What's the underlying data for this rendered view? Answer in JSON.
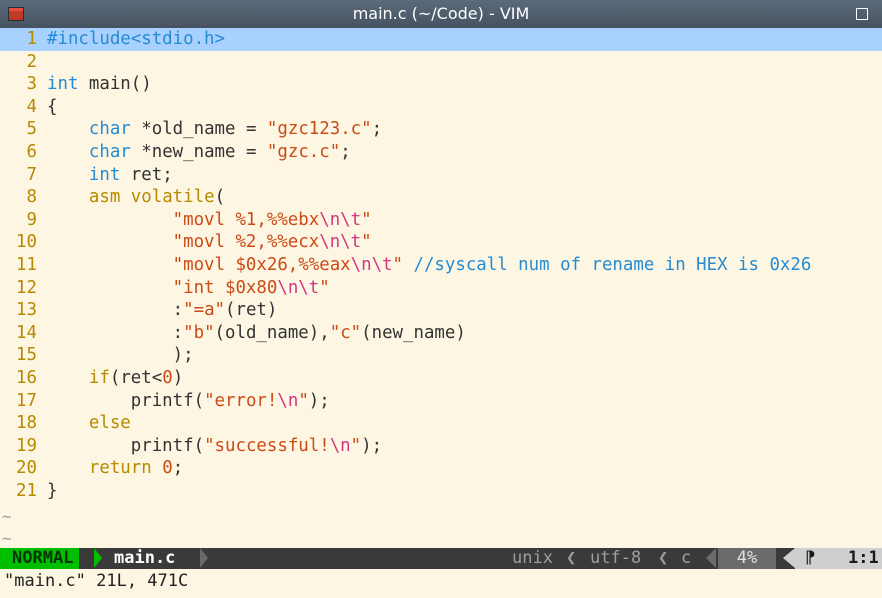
{
  "window": {
    "title": "main.c (~/Code) - VIM",
    "icon": "vim-app-icon"
  },
  "editor": {
    "lines": [
      {
        "n": "1",
        "segs": [
          {
            "t": "#include<stdio.h>",
            "c": "kw"
          }
        ]
      },
      {
        "n": "2",
        "segs": []
      },
      {
        "n": "3",
        "segs": [
          {
            "t": "int",
            "c": "kw"
          },
          {
            "t": " main()",
            "c": "code"
          }
        ]
      },
      {
        "n": "4",
        "segs": [
          {
            "t": "{",
            "c": "code"
          }
        ]
      },
      {
        "n": "5",
        "segs": [
          {
            "t": "    ",
            "c": "code"
          },
          {
            "t": "char",
            "c": "kw"
          },
          {
            "t": " *old_name = ",
            "c": "code"
          },
          {
            "t": "\"gzc123.c\"",
            "c": "strc"
          },
          {
            "t": ";",
            "c": "code"
          }
        ]
      },
      {
        "n": "6",
        "segs": [
          {
            "t": "    ",
            "c": "code"
          },
          {
            "t": "char",
            "c": "kw"
          },
          {
            "t": " *new_name = ",
            "c": "code"
          },
          {
            "t": "\"gzc.c\"",
            "c": "strc"
          },
          {
            "t": ";",
            "c": "code"
          }
        ]
      },
      {
        "n": "7",
        "segs": [
          {
            "t": "    ",
            "c": "code"
          },
          {
            "t": "int",
            "c": "kw"
          },
          {
            "t": " ret;",
            "c": "code"
          }
        ]
      },
      {
        "n": "8",
        "segs": [
          {
            "t": "    ",
            "c": "code"
          },
          {
            "t": "asm",
            "c": "kw2"
          },
          {
            "t": " ",
            "c": "code"
          },
          {
            "t": "volatile",
            "c": "kw2"
          },
          {
            "t": "(",
            "c": "code"
          }
        ]
      },
      {
        "n": "9",
        "segs": [
          {
            "t": "            ",
            "c": "code"
          },
          {
            "t": "\"movl %1,%%ebx",
            "c": "strc"
          },
          {
            "t": "\\n\\t",
            "c": "esc"
          },
          {
            "t": "\"",
            "c": "strc"
          }
        ]
      },
      {
        "n": "10",
        "segs": [
          {
            "t": "            ",
            "c": "code"
          },
          {
            "t": "\"movl %2,%%ecx",
            "c": "strc"
          },
          {
            "t": "\\n\\t",
            "c": "esc"
          },
          {
            "t": "\"",
            "c": "strc"
          }
        ]
      },
      {
        "n": "11",
        "segs": [
          {
            "t": "            ",
            "c": "code"
          },
          {
            "t": "\"movl $0x26,%%eax",
            "c": "strc"
          },
          {
            "t": "\\n\\t",
            "c": "esc"
          },
          {
            "t": "\"",
            "c": "strc"
          },
          {
            "t": " //syscall num of rename in HEX is 0x26",
            "c": "cmt"
          }
        ]
      },
      {
        "n": "12",
        "segs": [
          {
            "t": "            ",
            "c": "code"
          },
          {
            "t": "\"int $0x80",
            "c": "strc"
          },
          {
            "t": "\\n\\t",
            "c": "esc"
          },
          {
            "t": "\"",
            "c": "strc"
          }
        ]
      },
      {
        "n": "13",
        "segs": [
          {
            "t": "            :",
            "c": "code"
          },
          {
            "t": "\"=a\"",
            "c": "strc"
          },
          {
            "t": "(ret)",
            "c": "code"
          }
        ]
      },
      {
        "n": "14",
        "segs": [
          {
            "t": "            :",
            "c": "code"
          },
          {
            "t": "\"b\"",
            "c": "strc"
          },
          {
            "t": "(old_name),",
            "c": "code"
          },
          {
            "t": "\"c\"",
            "c": "strc"
          },
          {
            "t": "(new_name)",
            "c": "code"
          }
        ]
      },
      {
        "n": "15",
        "segs": [
          {
            "t": "            );",
            "c": "code"
          }
        ]
      },
      {
        "n": "16",
        "segs": [
          {
            "t": "    ",
            "c": "code"
          },
          {
            "t": "if",
            "c": "kw2"
          },
          {
            "t": "(ret<",
            "c": "code"
          },
          {
            "t": "0",
            "c": "num"
          },
          {
            "t": ")",
            "c": "code"
          }
        ]
      },
      {
        "n": "17",
        "segs": [
          {
            "t": "        printf(",
            "c": "code"
          },
          {
            "t": "\"error!",
            "c": "strc"
          },
          {
            "t": "\\n",
            "c": "esc"
          },
          {
            "t": "\"",
            "c": "strc"
          },
          {
            "t": ");",
            "c": "code"
          }
        ]
      },
      {
        "n": "18",
        "segs": [
          {
            "t": "    ",
            "c": "code"
          },
          {
            "t": "else",
            "c": "kw2"
          }
        ]
      },
      {
        "n": "19",
        "segs": [
          {
            "t": "        printf(",
            "c": "code"
          },
          {
            "t": "\"successful!",
            "c": "strc"
          },
          {
            "t": "\\n",
            "c": "esc"
          },
          {
            "t": "\"",
            "c": "strc"
          },
          {
            "t": ");",
            "c": "code"
          }
        ]
      },
      {
        "n": "20",
        "segs": [
          {
            "t": "    ",
            "c": "code"
          },
          {
            "t": "return",
            "c": "kw2"
          },
          {
            "t": " ",
            "c": "code"
          },
          {
            "t": "0",
            "c": "num"
          },
          {
            "t": ";",
            "c": "code"
          }
        ]
      },
      {
        "n": "21",
        "segs": [
          {
            "t": "}",
            "c": "code"
          }
        ]
      }
    ],
    "empty_marker": "~",
    "current_line": 1
  },
  "statusline": {
    "mode": "NORMAL",
    "filename": "main.c",
    "fileformat": "unix",
    "encoding": "utf-8",
    "filetype": "c",
    "percent": "4%",
    "position": "1:1"
  },
  "cmdline": {
    "message": "\"main.c\" 21L, 471C"
  },
  "colors": {
    "mode_bg": "#00bf00",
    "current_line_bg": "#a8d1ff",
    "editor_bg": "#fdf6e3"
  }
}
